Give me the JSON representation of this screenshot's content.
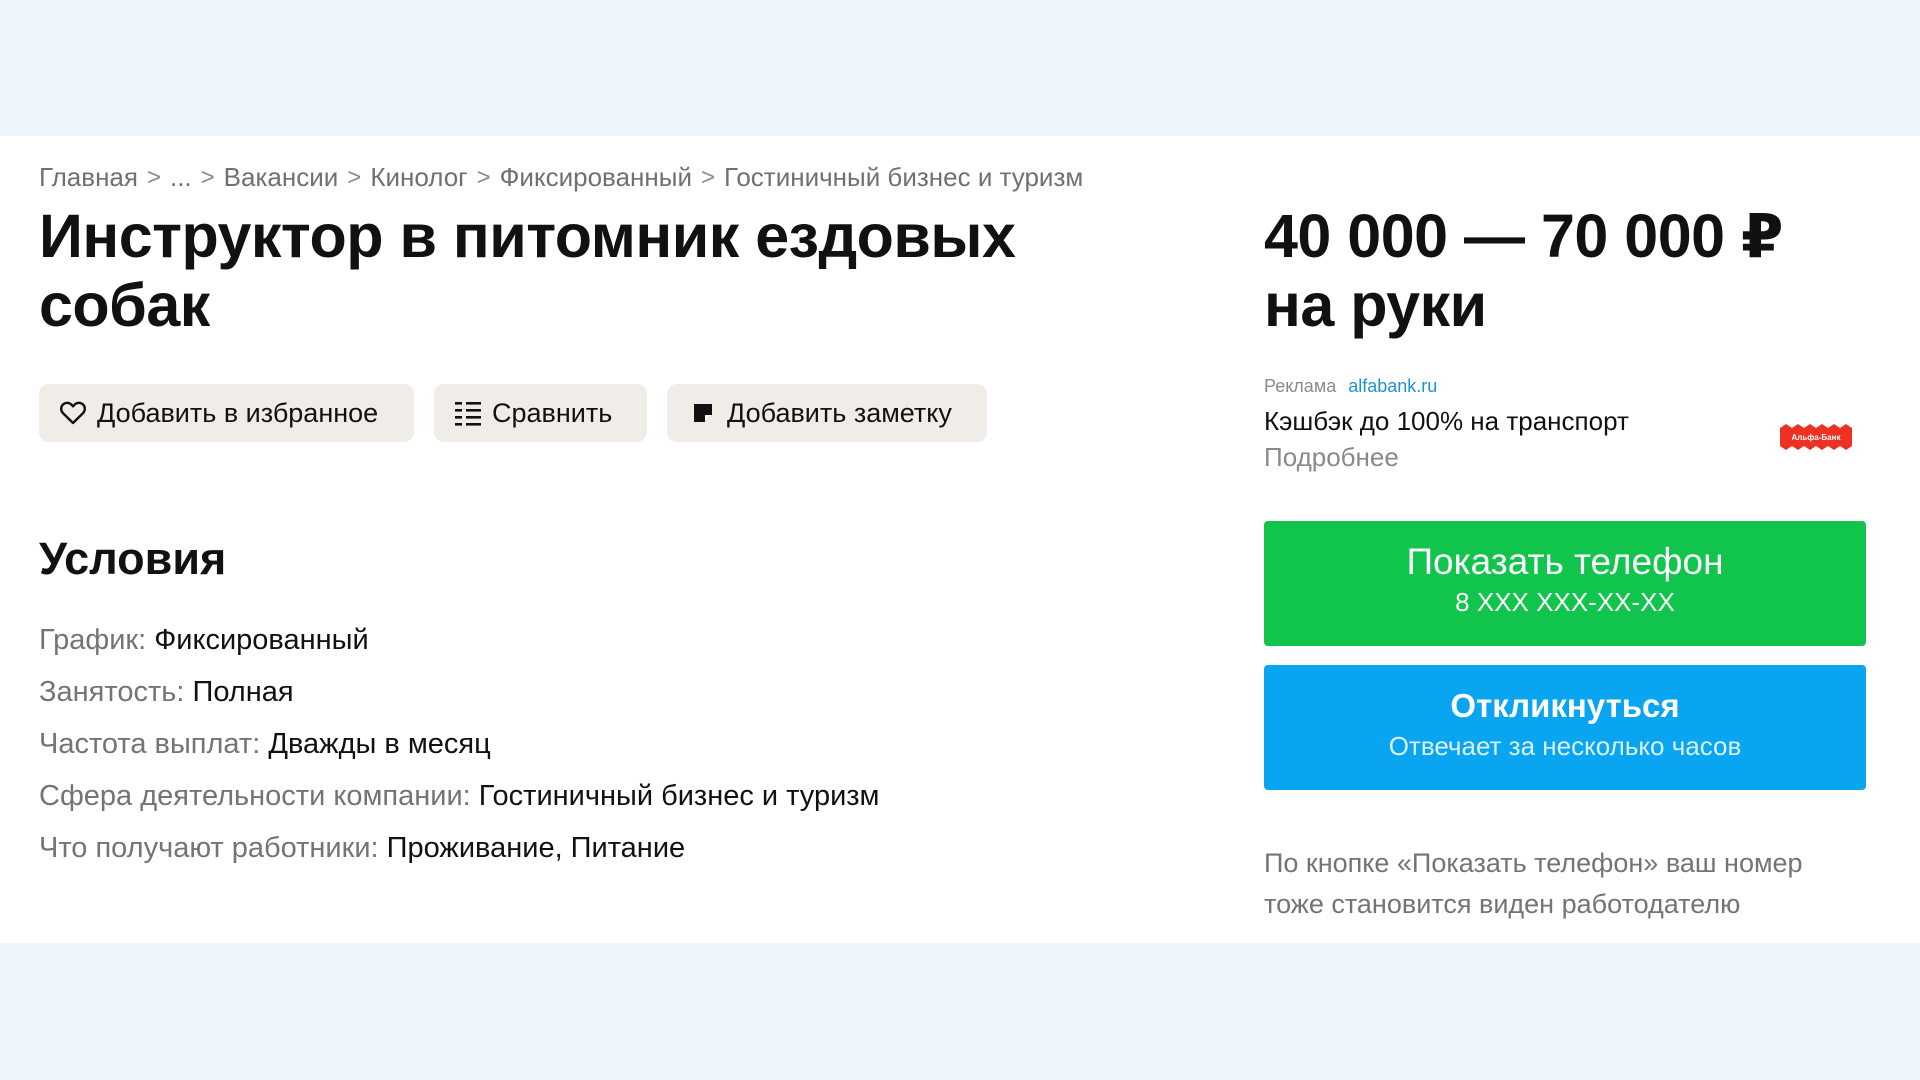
{
  "breadcrumb": {
    "items": [
      "Главная",
      "...",
      "Вакансии",
      "Кинолог",
      "Фиксированный",
      "Гостиничный бизнес и туризм"
    ],
    "separator": ">"
  },
  "job": {
    "title": "Инструктор в питомник ездовых собак",
    "salary": "40 000 — 70 000 ₽ на руки"
  },
  "actions": {
    "favorite": "Добавить в избранное",
    "compare": "Сравнить",
    "note": "Добавить заметку"
  },
  "conditions": {
    "title": "Условия",
    "items": [
      {
        "label": "График:",
        "value": "Фиксированный"
      },
      {
        "label": "Занятость:",
        "value": "Полная"
      },
      {
        "label": "Частота выплат:",
        "value": "Дважды в месяц"
      },
      {
        "label": "Сфера деятельности компании:",
        "value": "Гостиничный бизнес и туризм"
      },
      {
        "label": "Что получают работники:",
        "value": "Проживание, Питание"
      }
    ]
  },
  "ad": {
    "label": "Реклама",
    "link": "alfabank.ru",
    "text": "Кэшбэк до 100% на транспорт",
    "more": "Подробнее",
    "logo_text": "Альфа-Банк",
    "logo_icon": "alfabank-logo"
  },
  "phone_button": {
    "label": "Показать телефон",
    "number": "8 XXX XXX-XX-XX"
  },
  "respond_button": {
    "label": "Откликнуться",
    "sub": "Отвечает за несколько часов"
  },
  "note": "По кнопке «Показать телефон» ваш номер тоже становится виден работодателю",
  "colors": {
    "background": "#eef5fd",
    "card": "#ffffff",
    "action_bg": "#f0ede8",
    "green": "#10c44c",
    "blue": "#0aa5f0",
    "link": "#1e90d6",
    "alfa_red": "#ef3124"
  }
}
